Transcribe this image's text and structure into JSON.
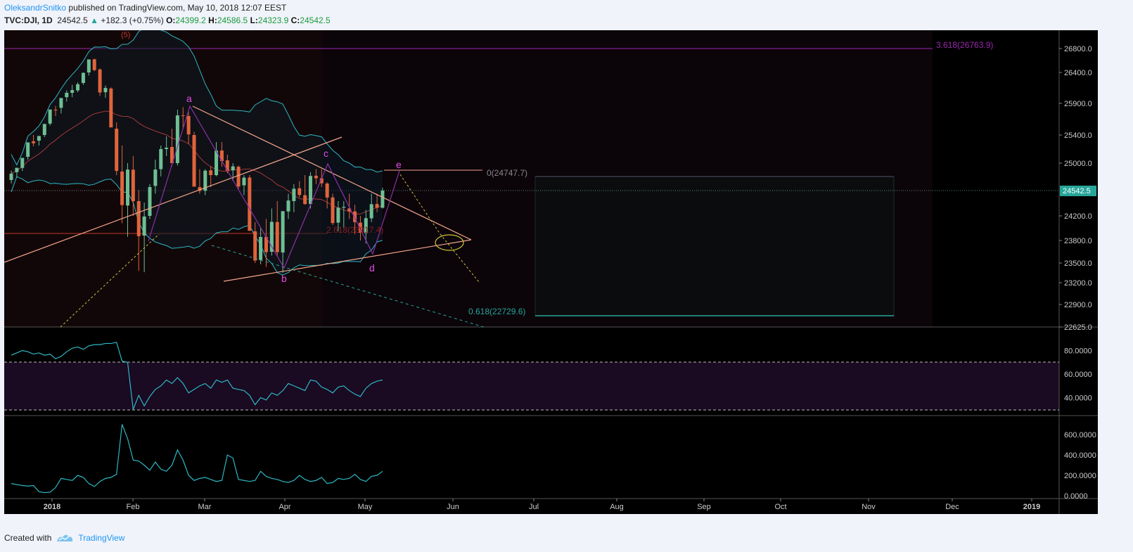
{
  "header": {
    "author": "OleksandrSnitko",
    "published": "published on TradingView.com, May 10, 2018 12:07 EEST"
  },
  "ticker": {
    "symbol": "TVC:DJI, 1D",
    "last": "24542.5",
    "change": "+182.3 (+0.75%)",
    "o_label": "O:",
    "o": "24399.2",
    "h_label": "H:",
    "h": "24586.5",
    "l_label": "L:",
    "l": "24323.9",
    "c_label": "C:",
    "c": "24542.5"
  },
  "footer": {
    "created_with": "Created with",
    "brand": "TradingView"
  },
  "colors": {
    "background": "#000000",
    "up_candle": "#6fbf93",
    "down_candle": "#e0643c",
    "wave_label": "#e14be8",
    "bollinger": "#2db7c2",
    "fib_green": "#26a69a",
    "fib_purple": "#9c27b0",
    "trendline": "#f4a58a"
  },
  "chart_data": {
    "type": "candlestick",
    "symbol": "TVC:DJI",
    "interval": "1D",
    "x_ticks": [
      "2018",
      "Feb",
      "Mar",
      "Apr",
      "May",
      "Jun",
      "Jul",
      "Aug",
      "Sep",
      "Oct",
      "Nov",
      "Dec",
      "2019"
    ],
    "price_axis_ticks": [
      26800.0,
      26400.0,
      25900.0,
      25400.0,
      25000.0,
      24200.0,
      23800.0,
      23500.0,
      23200.0,
      22900.0,
      22625.0
    ],
    "price_axis_tick_labels": [
      "26800.0",
      "26400.0",
      "25900.0",
      "25400.0",
      "25000.0",
      "24200.0",
      "23800.0",
      "23500.0",
      "23200.0",
      "22900.0",
      "22625.0"
    ],
    "last_price_label": "24542.5",
    "wave_labels": [
      "(5)",
      "a",
      "b",
      "c",
      "d",
      "e"
    ],
    "annotations": {
      "fib_3618": "3.618(26763.9)",
      "fib_0": "0(24747.7)",
      "fib_0618": "0.618(22729.6)",
      "fib_2618": "2.618(23917.4)"
    },
    "candles_ohlc": [
      [
        24719,
        24876,
        24662,
        24824
      ],
      [
        24850,
        24925,
        24760,
        24922
      ],
      [
        24920,
        25075,
        24870,
        25075
      ],
      [
        25090,
        25295,
        25050,
        25295
      ],
      [
        25310,
        25400,
        25240,
        25283
      ],
      [
        25320,
        25390,
        25250,
        25385
      ],
      [
        25400,
        25580,
        25370,
        25574
      ],
      [
        25580,
        25800,
        25550,
        25803
      ],
      [
        25800,
        25860,
        25700,
        25792
      ],
      [
        25830,
        25940,
        25740,
        25987
      ],
      [
        26000,
        26110,
        25930,
        26071
      ],
      [
        26070,
        26200,
        26000,
        26115
      ],
      [
        26110,
        26240,
        26080,
        26210
      ],
      [
        26230,
        26400,
        26200,
        26393
      ],
      [
        26400,
        26570,
        26350,
        26617
      ],
      [
        26620,
        26630,
        26420,
        26439
      ],
      [
        26450,
        26470,
        26020,
        26076
      ],
      [
        26080,
        26190,
        25990,
        26149
      ],
      [
        26140,
        26160,
        25650,
        25520
      ],
      [
        25500,
        25600,
        24800,
        24870
      ],
      [
        24860,
        25250,
        24080,
        24346
      ],
      [
        24340,
        25000,
        23860,
        24893
      ],
      [
        24890,
        25100,
        24200,
        24400
      ],
      [
        24400,
        24550,
        23380,
        23870
      ],
      [
        23880,
        24380,
        23360,
        24190
      ],
      [
        24200,
        24650,
        24150,
        24601
      ],
      [
        24620,
        25050,
        24500,
        24893
      ],
      [
        24900,
        25250,
        24780,
        25200
      ],
      [
        25200,
        25380,
        25100,
        25219
      ],
      [
        25230,
        25500,
        24950,
        25000
      ],
      [
        25000,
        25800,
        24960,
        25710
      ],
      [
        25710,
        25840,
        25500,
        25709
      ],
      [
        25700,
        25760,
        25270,
        25410
      ],
      [
        25400,
        25450,
        24800,
        24608
      ],
      [
        24600,
        24900,
        24500,
        24538
      ],
      [
        24540,
        24900,
        24480,
        24874
      ],
      [
        24880,
        24950,
        24600,
        24801
      ],
      [
        24800,
        25300,
        24780,
        25178
      ],
      [
        25180,
        25300,
        24940,
        25029
      ],
      [
        25040,
        25120,
        24830,
        24873
      ],
      [
        24880,
        25000,
        24700,
        24946
      ],
      [
        24940,
        24960,
        24550,
        24610
      ],
      [
        24630,
        24800,
        24480,
        24758
      ],
      [
        24760,
        24800,
        24050,
        23957
      ],
      [
        23950,
        24100,
        23500,
        23533
      ],
      [
        23540,
        24000,
        23480,
        23858
      ],
      [
        23860,
        24150,
        23440,
        23644
      ],
      [
        23650,
        24300,
        23600,
        24103
      ],
      [
        24100,
        24400,
        23600,
        23644
      ],
      [
        23640,
        24200,
        23350,
        24264
      ],
      [
        24260,
        24500,
        24150,
        24408
      ],
      [
        24400,
        24650,
        24250,
        24573
      ],
      [
        24580,
        24700,
        24450,
        24483
      ],
      [
        24480,
        24800,
        24350,
        24360
      ],
      [
        24360,
        24850,
        24300,
        24786
      ],
      [
        24790,
        24900,
        24650,
        24748
      ],
      [
        24750,
        24900,
        24600,
        24664
      ],
      [
        24660,
        24680,
        24300,
        24448
      ],
      [
        24450,
        24500,
        24050,
        24083
      ],
      [
        24090,
        24400,
        23950,
        24311
      ],
      [
        24310,
        24400,
        24000,
        24322
      ],
      [
        24300,
        24500,
        24150,
        24262
      ],
      [
        24260,
        24350,
        23900,
        24099
      ],
      [
        24090,
        24200,
        23800,
        23925
      ],
      [
        23920,
        24280,
        23760,
        24163
      ],
      [
        24160,
        24500,
        24100,
        24358
      ],
      [
        24360,
        24500,
        24250,
        24310
      ],
      [
        24310,
        24590,
        24300,
        24543
      ]
    ],
    "rsi": {
      "name": "",
      "y_ticks": [
        "80.0000",
        "60.0000",
        "40.0000"
      ],
      "overbought": 70,
      "oversold": 30,
      "values": [
        76,
        78,
        80,
        79,
        77,
        78,
        76,
        77,
        73,
        75,
        79,
        82,
        83,
        81,
        84,
        85,
        85,
        86,
        86,
        87,
        71,
        70,
        30,
        42,
        33,
        41,
        47,
        50,
        55,
        52,
        57,
        52,
        44,
        47,
        50,
        52,
        48,
        55,
        53,
        55,
        48,
        47,
        46,
        42,
        34,
        40,
        38,
        44,
        42,
        46,
        52,
        50,
        48,
        46,
        55,
        54,
        49,
        47,
        44,
        49,
        50,
        46,
        43,
        41,
        48,
        52,
        54,
        55
      ]
    },
    "volume_like": {
      "name": "",
      "y_ticks": [
        "600.0000",
        "400.0000",
        "200.0000",
        "0.0000"
      ],
      "values": [
        120,
        110,
        100,
        95,
        100,
        40,
        30,
        35,
        80,
        170,
        160,
        150,
        200,
        180,
        120,
        90,
        140,
        170,
        180,
        210,
        700,
        560,
        350,
        340,
        300,
        250,
        330,
        260,
        240,
        300,
        450,
        350,
        200,
        150,
        170,
        180,
        160,
        140,
        150,
        400,
        370,
        160,
        150,
        140,
        150,
        240,
        190,
        170,
        160,
        140,
        130,
        150,
        200,
        160,
        140,
        150,
        180,
        120,
        130,
        170,
        160,
        170,
        210,
        160,
        140,
        190,
        200,
        240
      ]
    },
    "ylim": [
      22625.0,
      27000.0
    ],
    "grid": false,
    "legend": "none"
  }
}
